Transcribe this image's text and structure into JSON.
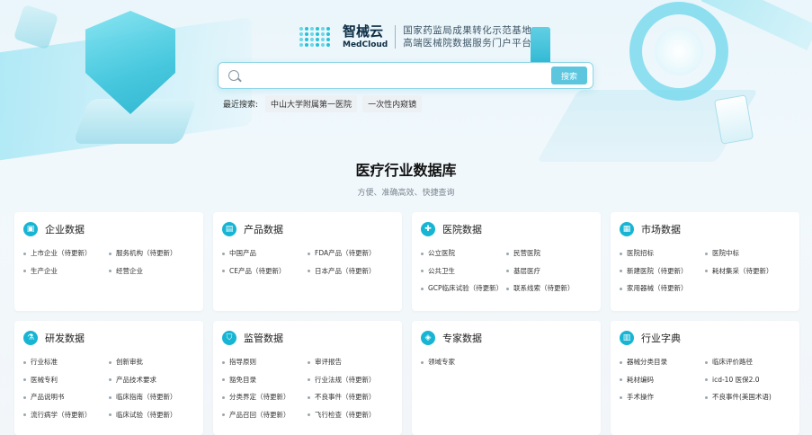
{
  "brand": {
    "name_cn": "智械云",
    "name_en": "MedCloud",
    "slogan_line1": "国家药监局成果转化示范基地",
    "slogan_line2": "高端医械院数据服务门户平台"
  },
  "search": {
    "placeholder": "",
    "button_label": "搜索",
    "recent_label": "最近搜索:",
    "recent_tags": [
      "中山大学附属第一医院",
      "一次性内窥镜"
    ]
  },
  "section": {
    "title": "医疗行业数据库",
    "subtitle": "方便、准确高效、快捷查询"
  },
  "cards": [
    {
      "title": "企业数据",
      "icon": "box-icon",
      "glyph": "▣",
      "items": [
        "上市企业（待更新）",
        "服务机构（待更新）",
        "生产企业",
        "经营企业"
      ]
    },
    {
      "title": "产品数据",
      "icon": "product-icon",
      "glyph": "▤",
      "items": [
        "中国产品",
        "FDA产品（待更新）",
        "CE产品（待更新）",
        "日本产品（待更新）"
      ]
    },
    {
      "title": "医院数据",
      "icon": "hospital-icon",
      "glyph": "✚",
      "items": [
        "公立医院",
        "民营医院",
        "公共卫生",
        "基层医疗",
        "GCP临床试验（待更新）",
        "联系线索（待更新）"
      ]
    },
    {
      "title": "市场数据",
      "icon": "market-icon",
      "glyph": "▦",
      "items": [
        "医院招标",
        "医院中标",
        "新建医院（待更新）",
        "耗材集采（待更新）",
        "家用器械（待更新）"
      ]
    },
    {
      "title": "研发数据",
      "icon": "research-icon",
      "glyph": "⚗",
      "items": [
        "行业标准",
        "创新审批",
        "医械专利",
        "产品技术要求",
        "产品说明书",
        "临床指南（待更新）",
        "流行病学（待更新）",
        "临床试验（待更新）"
      ]
    },
    {
      "title": "监管数据",
      "icon": "shield-icon",
      "glyph": "⛉",
      "items": [
        "指导原则",
        "审评报告",
        "豁免目录",
        "行业法规（待更新）",
        "分类界定（待更新）",
        "不良事件（待更新）",
        "产品召回（待更新）",
        "飞行检查（待更新）"
      ]
    },
    {
      "title": "专家数据",
      "icon": "expert-icon",
      "glyph": "◈",
      "items": [
        "领域专家"
      ]
    },
    {
      "title": "行业字典",
      "icon": "dictionary-icon",
      "glyph": "▥",
      "items": [
        "器械分类目录",
        "临床评价路径",
        "耗材编码",
        "icd-10 医保2.0",
        "手术操作",
        "不良事件(美国术语)"
      ]
    }
  ],
  "colors": {
    "accent": "#17b5d3",
    "search_button": "#5cc6de",
    "search_border": "#8fd6e6"
  }
}
